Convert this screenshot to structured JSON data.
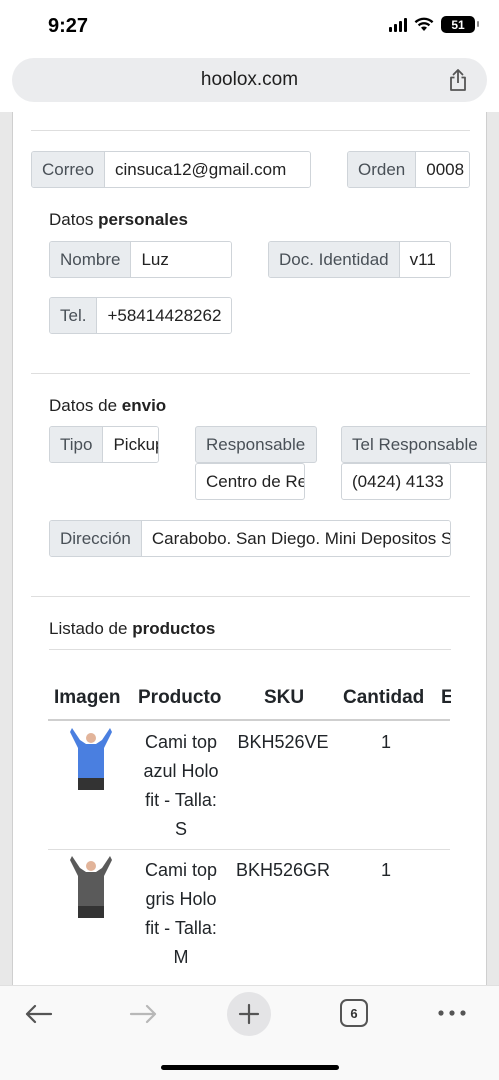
{
  "status_bar": {
    "time": "9:27",
    "battery": "51"
  },
  "browser": {
    "url": "hoolox.com",
    "tab_count": "6"
  },
  "order": {
    "email": {
      "label": "Correo",
      "value": "cinsuca12@gmail.com"
    },
    "number": {
      "label": "Orden",
      "value": "0008"
    }
  },
  "personal": {
    "title_prefix": "Datos",
    "title_bold": "personales",
    "name": {
      "label": "Nombre",
      "value": "Luz"
    },
    "id_doc": {
      "label": "Doc. Identidad",
      "value": "v11"
    },
    "phone": {
      "label": "Tel.",
      "value": "+58414428262"
    }
  },
  "shipping": {
    "title_prefix": "Datos de",
    "title_bold": "envio",
    "type": {
      "label": "Tipo",
      "value": "Pickup"
    },
    "responsible": {
      "label": "Responsable",
      "value": "Centro de Retiro"
    },
    "responsible_phone": {
      "label": "Tel Responsable",
      "value": "(0424) 4133"
    },
    "address": {
      "label": "Dirección",
      "value": "Carabobo. San Diego. Mini Depositos S"
    }
  },
  "products": {
    "title_prefix": "Listado de",
    "title_bold": "productos",
    "columns": [
      "Imagen",
      "Producto",
      "SKU",
      "Cantidad",
      "E"
    ],
    "rows": [
      {
        "image_color": "#4a7fe0",
        "name_lines": [
          "Cami top",
          "azul Holo",
          "fit - Talla:",
          "S"
        ],
        "sku": "BKH526VE",
        "qty": "1"
      },
      {
        "image_color": "#5a5a5a",
        "name_lines": [
          "Cami top",
          "gris Holo",
          "fit - Talla:",
          "M"
        ],
        "sku": "BKH526GR",
        "qty": "1"
      }
    ]
  },
  "icons": {
    "share": "share-icon",
    "back": "back-arrow-icon",
    "forward": "forward-arrow-icon",
    "new_tab": "plus-icon",
    "tabs": "tabs-icon",
    "more": "more-icon"
  }
}
